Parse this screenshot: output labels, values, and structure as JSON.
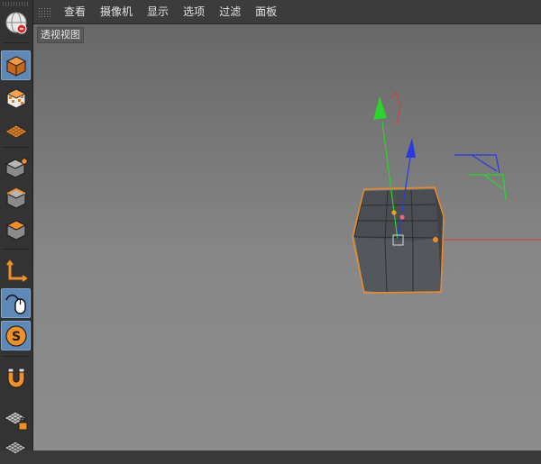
{
  "menu": {
    "items": [
      "查看",
      "摄像机",
      "显示",
      "选项",
      "过滤",
      "面板"
    ]
  },
  "viewport": {
    "label": "透视视图"
  },
  "toolbar": {
    "tools": [
      {
        "icon": "undo-view-globe-icon",
        "active": false
      },
      {
        "icon": "model-mode-cube-icon",
        "active": true
      },
      {
        "icon": "texture-mode-cube-icon",
        "active": false
      },
      {
        "icon": "workplane-grid-icon",
        "active": false
      },
      {
        "icon": "points-mode-icon",
        "active": false
      },
      {
        "icon": "edges-mode-icon",
        "active": false
      },
      {
        "icon": "polygons-mode-icon",
        "active": false
      },
      {
        "icon": "axis-mode-icon",
        "active": false
      },
      {
        "icon": "tweak-mouse-icon",
        "active": false
      },
      {
        "icon": "snap-icon",
        "active": false
      },
      {
        "icon": "magnet-icon",
        "active": false
      },
      {
        "icon": "workplane-lock-icon",
        "active": false
      },
      {
        "icon": "grid-icon",
        "active": false
      }
    ]
  },
  "colors": {
    "active_tool": "#5e88b6",
    "axis_x": "#e03a3a",
    "axis_y": "#2ad42a",
    "axis_z": "#2a3ae0",
    "selection": "#f08a24"
  }
}
